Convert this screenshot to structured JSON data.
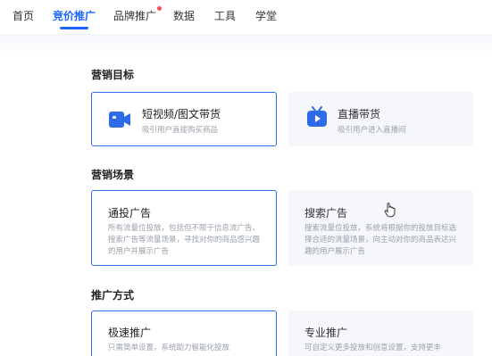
{
  "nav": {
    "items": [
      "首页",
      "竞价推广",
      "品牌推广",
      "数据",
      "工具",
      "学堂"
    ]
  },
  "sections": {
    "goal": {
      "title": "营销目标",
      "cards": [
        {
          "title": "短视频/图文带货",
          "desc": "吸引用户直接购买商品",
          "icon": "video-icon"
        },
        {
          "title": "直播带货",
          "desc": "吸引用户进入直播间",
          "icon": "live-tv-icon"
        }
      ]
    },
    "scene": {
      "title": "营销场景",
      "cards": [
        {
          "title": "通投广告",
          "desc": "所有流量位投放，包括但不限于信息流广告、搜索广告等流量场景，寻找对你的商品感兴趣的用户并展示广告"
        },
        {
          "title": "搜索广告",
          "desc": "搜索流量位投放，系统将根据你的投放目标选择合适的流量场景，向主动对你的商品表达兴趣的用户展示广告"
        }
      ]
    },
    "mode": {
      "title": "推广方式",
      "cards": [
        {
          "title": "极速推广",
          "desc": "只需简单设置，系统助力智能化投放"
        },
        {
          "title": "专业推广",
          "desc": "可自定义更多投放和创意设置，支持更丰"
        }
      ]
    }
  },
  "colors": {
    "accent": "#1a66ff",
    "selected_border": "#2e6be6",
    "badge": "#ff4d4f"
  }
}
